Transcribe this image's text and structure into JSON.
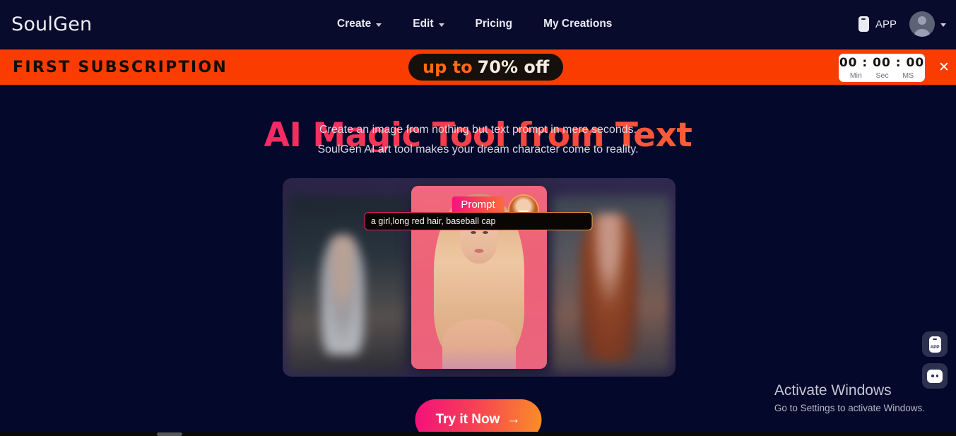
{
  "header": {
    "logo": "SoulGen",
    "nav": [
      {
        "label": "Create",
        "has_dropdown": true
      },
      {
        "label": "Edit",
        "has_dropdown": true
      },
      {
        "label": "Pricing",
        "has_dropdown": false
      },
      {
        "label": "My Creations",
        "has_dropdown": false
      }
    ],
    "app_label": "APP",
    "app_icon": "phone-icon",
    "avatar_icon": "user-avatar-icon",
    "avatar_caret_icon": "chevron-down-icon",
    "background_color": "#080b2c"
  },
  "promo_banner": {
    "title": "FIRST SUBSCRIPTION",
    "offer_prefix": "up to",
    "offer_main": "70% off",
    "timer": {
      "minutes": "00",
      "separator1": ":",
      "seconds": "00",
      "separator2": ":",
      "milliseconds": "00",
      "label_min": "Min",
      "label_sec": "Sec",
      "label_ms": "MS"
    },
    "close_icon": "close-icon",
    "close_label": "✕",
    "background_color": "#fa3c00",
    "pill_background": "#15100c",
    "accent_color": "#fb6a17"
  },
  "hero": {
    "title": "AI Magic Tool from Text",
    "subtitle_line1": "Create an image from nothing but text prompt in mere seconds.",
    "subtitle_line2": "SoulGen AI art tool makes your dream character come to reality.",
    "prompt_label": "Prompt",
    "prompt_value": "a girl,long red hair, baseball cap",
    "cta_label": "Try it Now",
    "cta_arrow": "→",
    "title_gradient_start": "#ec0f7a",
    "title_gradient_end": "#fd8b2a"
  },
  "float_buttons": [
    {
      "name": "app-download-button",
      "label": "APP",
      "icon": "phone-app-icon"
    },
    {
      "name": "chat-support-button",
      "label": "",
      "icon": "chat-bubble-icon"
    }
  ],
  "watermark": {
    "title": "Activate Windows",
    "subtitle": "Go to Settings to activate Windows."
  }
}
